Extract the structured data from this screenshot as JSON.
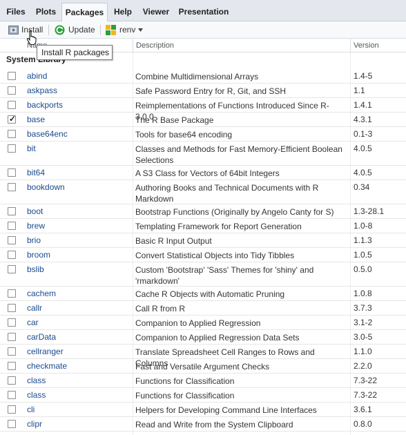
{
  "tabs": [
    {
      "label": "Files",
      "active": false
    },
    {
      "label": "Plots",
      "active": false
    },
    {
      "label": "Packages",
      "active": true
    },
    {
      "label": "Help",
      "active": false
    },
    {
      "label": "Viewer",
      "active": false
    },
    {
      "label": "Presentation",
      "active": false
    }
  ],
  "toolbar": {
    "install_label": "Install",
    "update_label": "Update",
    "renv_label": "renv",
    "install_icon": "install-box-icon",
    "update_icon": "refresh-icon",
    "renv_icon": "renv-icon"
  },
  "columns": {
    "name": "Name",
    "description": "Description",
    "version": "Version"
  },
  "section_title": "System Library",
  "tooltip": "Install R packages",
  "colors": {
    "accent": "#1a4a8e",
    "update_green": "#2e9e3a",
    "renv_yellow": "#f2b620",
    "tab_bar": "#e4e8ee"
  },
  "packages": [
    {
      "name": "abind",
      "description": "Combine Multidimensional Arrays",
      "version": "1.4-5",
      "checked": false
    },
    {
      "name": "askpass",
      "description": "Safe Password Entry for R, Git, and SSH",
      "version": "1.1",
      "checked": false
    },
    {
      "name": "backports",
      "description": "Reimplementations of Functions Introduced Since R-3.0.0",
      "version": "1.4.1",
      "checked": false
    },
    {
      "name": "base",
      "description": "The R Base Package",
      "version": "4.3.1",
      "checked": true
    },
    {
      "name": "base64enc",
      "description": "Tools for base64 encoding",
      "version": "0.1-3",
      "checked": false
    },
    {
      "name": "bit",
      "description": "Classes and Methods for Fast Memory-Efficient Boolean Selections",
      "version": "4.0.5",
      "checked": false
    },
    {
      "name": "bit64",
      "description": "A S3 Class for Vectors of 64bit Integers",
      "version": "4.0.5",
      "checked": false
    },
    {
      "name": "bookdown",
      "description": "Authoring Books and Technical Documents with R Markdown",
      "version": "0.34",
      "checked": false
    },
    {
      "name": "boot",
      "description": "Bootstrap Functions (Originally by Angelo Canty for S)",
      "version": "1.3-28.1",
      "checked": false
    },
    {
      "name": "brew",
      "description": "Templating Framework for Report Generation",
      "version": "1.0-8",
      "checked": false
    },
    {
      "name": "brio",
      "description": "Basic R Input Output",
      "version": "1.1.3",
      "checked": false
    },
    {
      "name": "broom",
      "description": "Convert Statistical Objects into Tidy Tibbles",
      "version": "1.0.5",
      "checked": false
    },
    {
      "name": "bslib",
      "description": "Custom 'Bootstrap' 'Sass' Themes for 'shiny' and 'rmarkdown'",
      "version": "0.5.0",
      "checked": false
    },
    {
      "name": "cachem",
      "description": "Cache R Objects with Automatic Pruning",
      "version": "1.0.8",
      "checked": false
    },
    {
      "name": "callr",
      "description": "Call R from R",
      "version": "3.7.3",
      "checked": false
    },
    {
      "name": "car",
      "description": "Companion to Applied Regression",
      "version": "3.1-2",
      "checked": false
    },
    {
      "name": "carData",
      "description": "Companion to Applied Regression Data Sets",
      "version": "3.0-5",
      "checked": false
    },
    {
      "name": "cellranger",
      "description": "Translate Spreadsheet Cell Ranges to Rows and Columns",
      "version": "1.1.0",
      "checked": false
    },
    {
      "name": "checkmate",
      "description": "Fast and Versatile Argument Checks",
      "version": "2.2.0",
      "checked": false
    },
    {
      "name": "class",
      "description": "Functions for Classification",
      "version": "7.3-22",
      "checked": false
    },
    {
      "name": "class",
      "description": "Functions for Classification",
      "version": "7.3-22",
      "checked": false
    },
    {
      "name": "cli",
      "description": "Helpers for Developing Command Line Interfaces",
      "version": "3.6.1",
      "checked": false
    },
    {
      "name": "clipr",
      "description": "Read and Write from the System Clipboard",
      "version": "0.8.0",
      "checked": false
    }
  ]
}
